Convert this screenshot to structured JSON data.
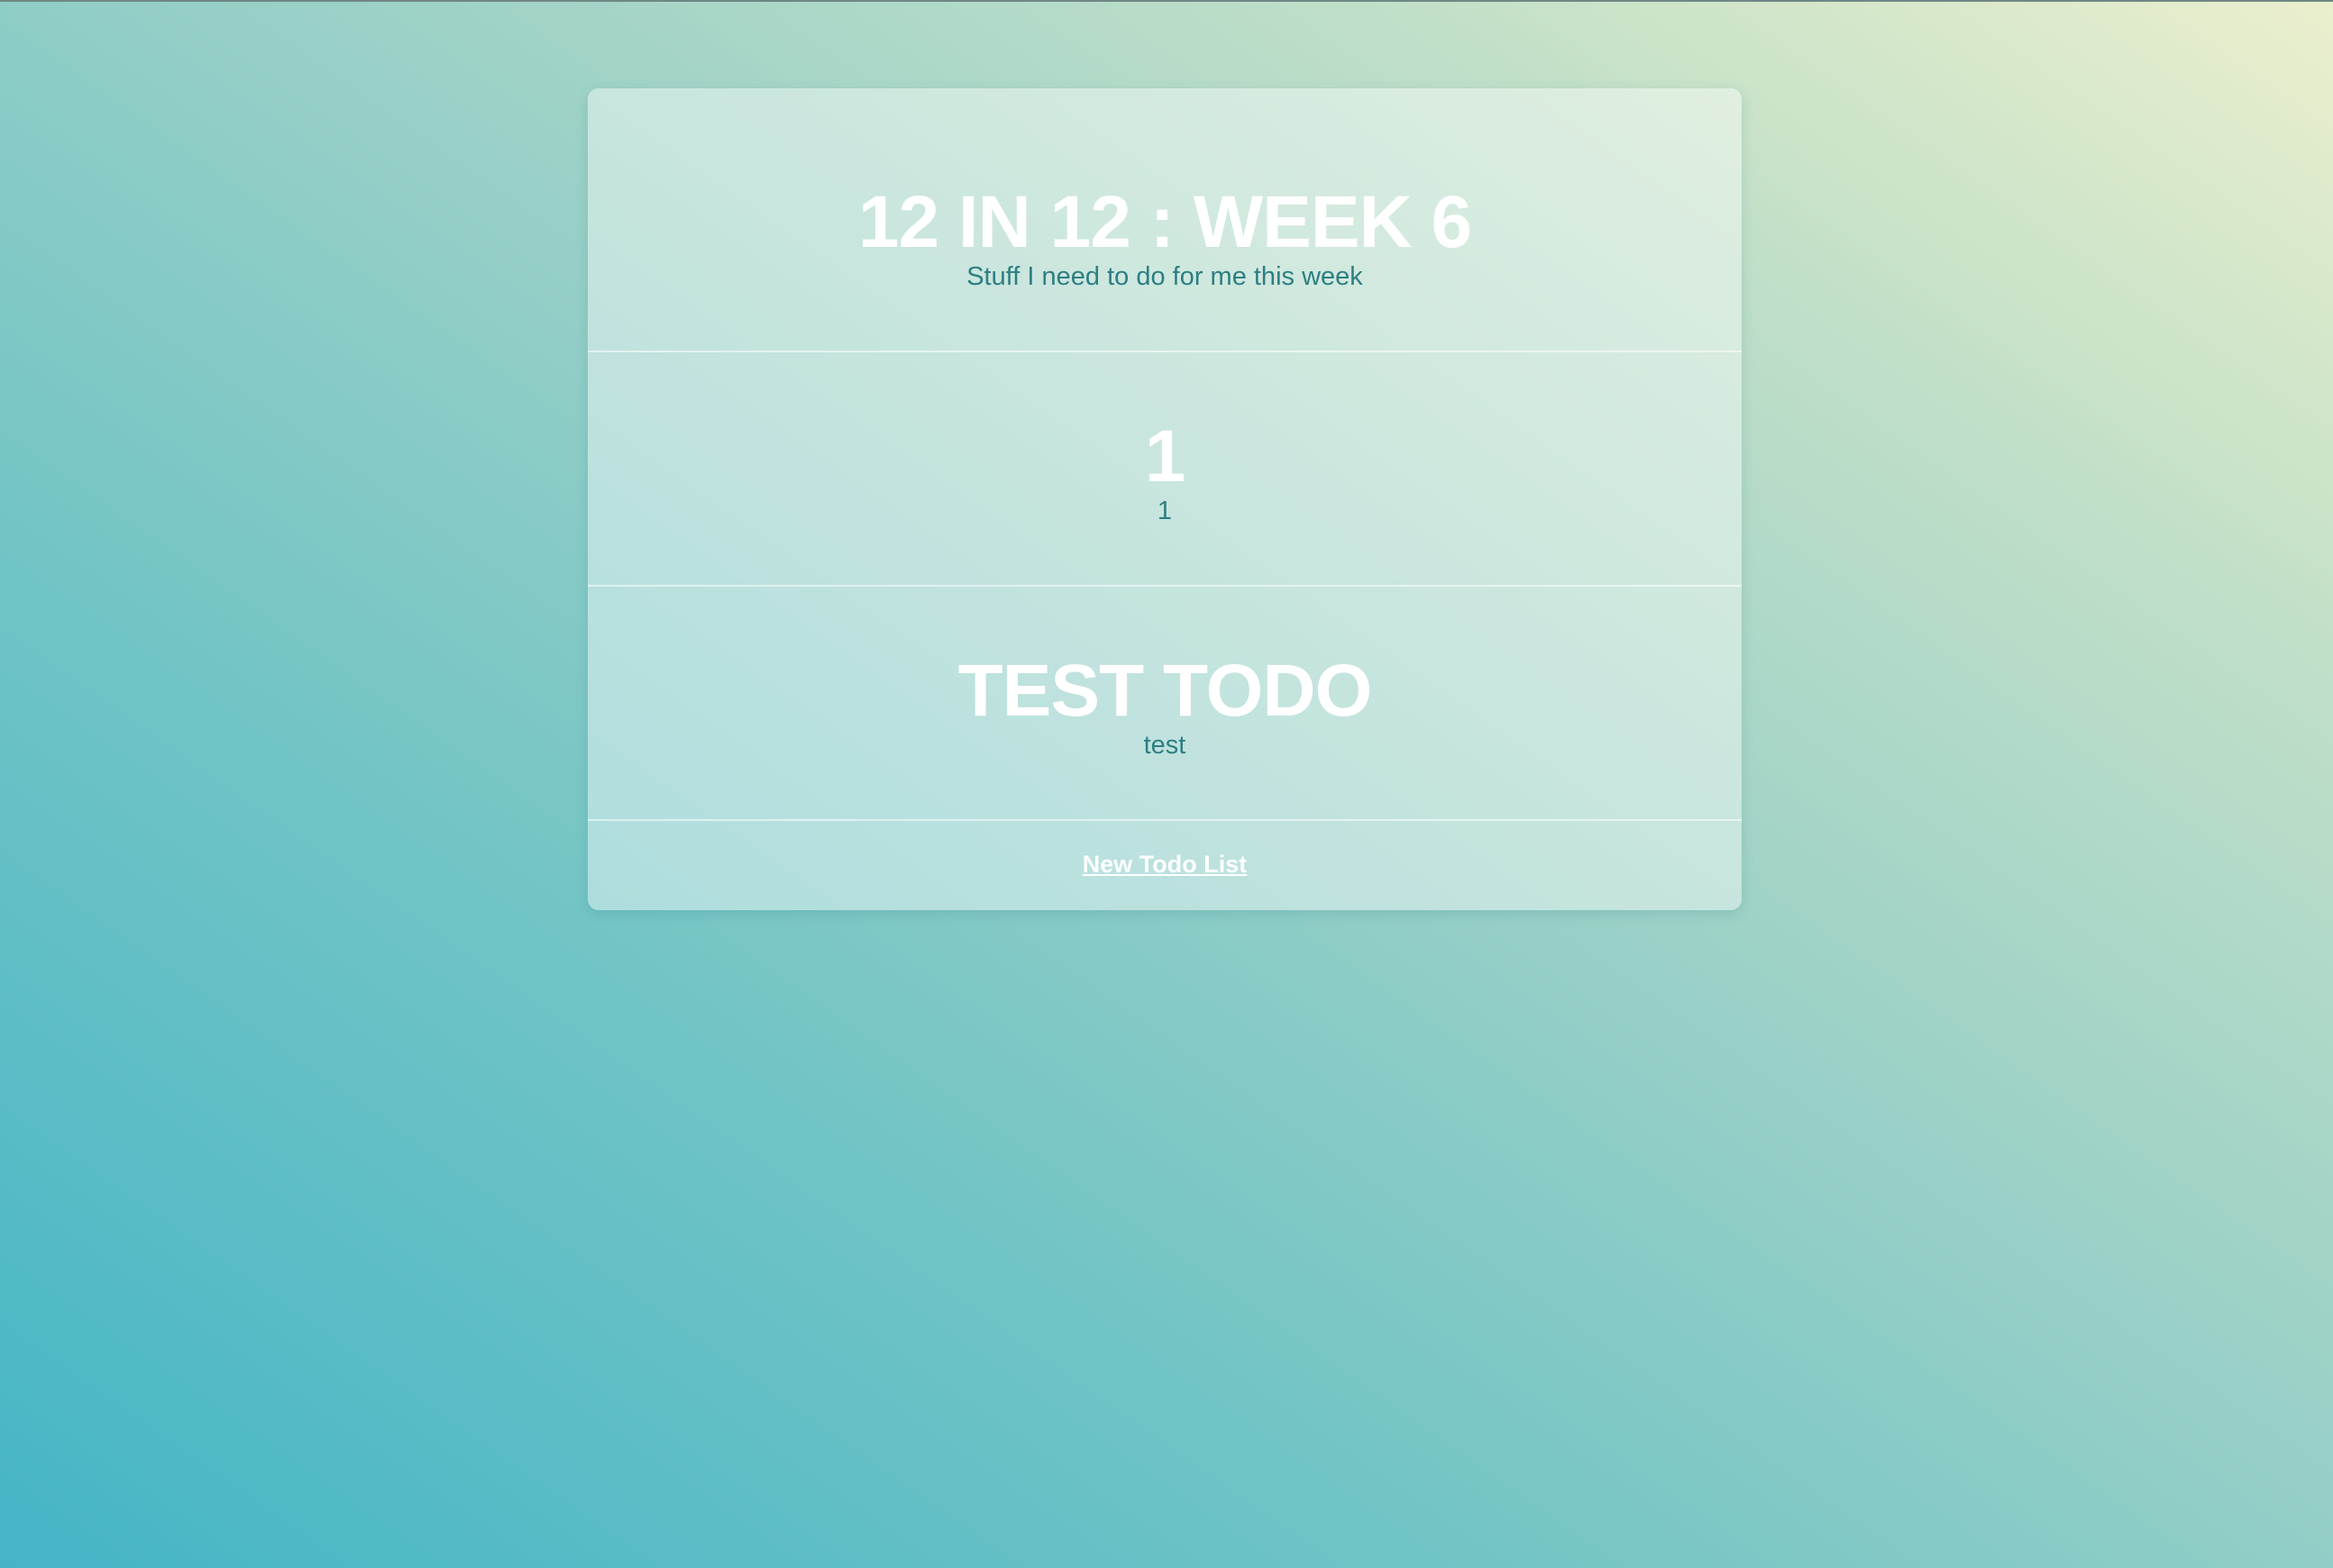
{
  "header": {
    "title": "12 IN 12 : WEEK 6",
    "subtitle": "Stuff I need to do for me this week"
  },
  "todos": [
    {
      "title": "1",
      "description": "1"
    },
    {
      "title": "TEST TODO",
      "description": "test"
    }
  ],
  "footer": {
    "new_list_label": "New Todo List"
  },
  "colors": {
    "title": "#ffffff",
    "subtitle": "#2d7f83",
    "gradient_start": "#45b5c6",
    "gradient_end": "#ebefcd"
  }
}
